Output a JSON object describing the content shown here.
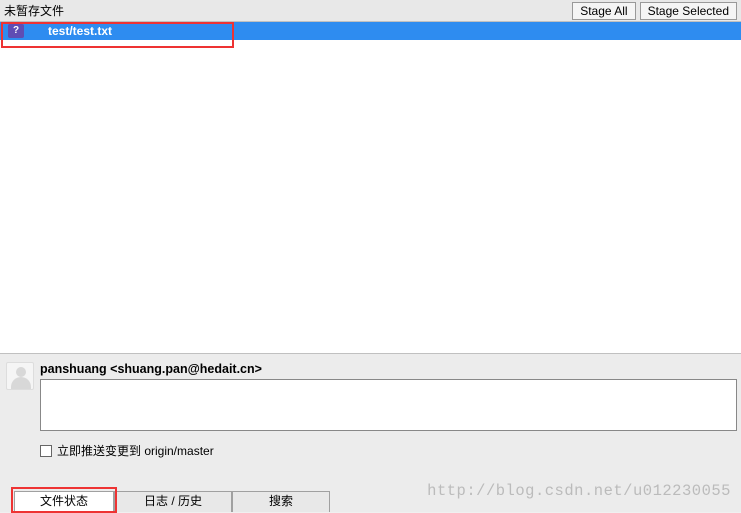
{
  "header": {
    "title": "未暂存文件",
    "stage_all_label": "Stage All",
    "stage_selected_label": "Stage Selected"
  },
  "file_list": {
    "items": [
      {
        "icon_glyph": "?",
        "path": "test/test.txt"
      }
    ]
  },
  "commit": {
    "author": "panshuang <shuang.pan@hedait.cn>",
    "message": "",
    "push_label": "立即推送变更到 origin/master",
    "push_checked": false
  },
  "tabs": {
    "file_status": "文件状态",
    "log_history": "日志 / 历史",
    "search": "搜索"
  },
  "watermark": "http://blog.csdn.net/u012230055"
}
